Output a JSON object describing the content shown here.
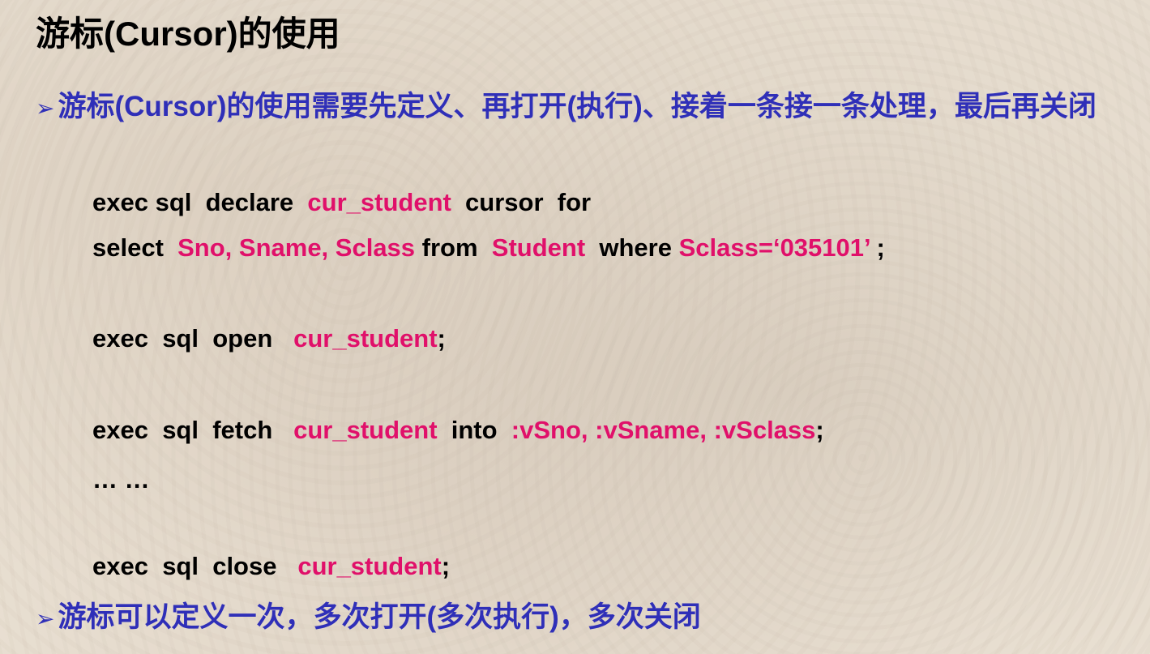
{
  "title": "游标(Cursor)的使用",
  "bullet1": "游标(Cursor)的使用需要先定义、再打开(执行)、接着一条接一条处理，最后再关闭",
  "bullet2": "游标可以定义一次，多次打开(多次执行)，多次关闭",
  "bullet_marker": "➢",
  "colors": {
    "keyword": "#000000",
    "identifier": "#e0106a",
    "bullet": "#2f2fb8"
  },
  "code": {
    "line1": {
      "a": "exec sql  declare  ",
      "b": "cur_student",
      "c": "  cursor  for"
    },
    "line2": {
      "a": "select  ",
      "b": "Sno, Sname, Sclass",
      "c": " from  ",
      "d": "Student",
      "e": "  where ",
      "f": "Sclass=‘035101’",
      "g": " ;"
    },
    "line3": {
      "a": "exec  sql  open   ",
      "b": "cur_student",
      "c": ";"
    },
    "line4": {
      "a": "exec  sql  fetch   ",
      "b": "cur_student",
      "c": "  into  ",
      "d": ":vSno, :vSname, :vSclass",
      "e": ";"
    },
    "line5": {
      "a": "… …"
    },
    "line6": {
      "a": "exec  sql  close   ",
      "b": "cur_student",
      "c": ";"
    }
  }
}
